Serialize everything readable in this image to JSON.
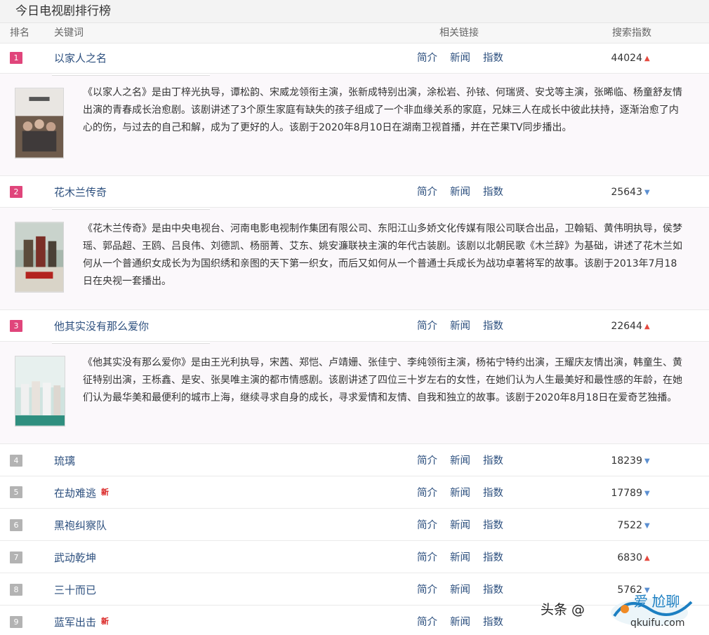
{
  "page": {
    "title": "今日电视剧排行榜"
  },
  "table_header": {
    "rank": "排名",
    "keyword": "关键词",
    "links": "相关链接",
    "index": "搜索指数"
  },
  "link_labels": {
    "intro": "简介",
    "news": "新闻",
    "index": "指数"
  },
  "items": [
    {
      "rank": "1",
      "keyword": "以家人之名",
      "index": "44024",
      "trend": "up",
      "is_new": false,
      "description": "《以家人之名》是由丁梓光执导，谭松韵、宋威龙领衔主演，张新成特别出演，涂松岩、孙铱、何瑞贤、安戈等主演，张晞临、杨童舒友情出演的青春成长治愈剧。该剧讲述了3个原生家庭有缺失的孩子组成了一个非血缘关系的家庭，兄妹三人在成长中彼此扶持，逐渐治愈了内心的伤，与过去的自己和解，成为了更好的人。该剧于2020年8月10日在湖南卫视首播，并在芒果TV同步播出。"
    },
    {
      "rank": "2",
      "keyword": "花木兰传奇",
      "index": "25643",
      "trend": "down",
      "is_new": false,
      "description": "《花木兰传奇》是由中央电视台、河南电影电视制作集团有限公司、东阳江山多娇文化传媒有限公司联合出品，卫翰韬、黄伟明执导，侯梦瑶、郭品超、王鸥、吕良伟、刘德凯、杨丽菁、艾东、姚安濂联袂主演的年代古装剧。该剧以北朝民歌《木兰辞》为基础，讲述了花木兰如何从一个普通织女成长为为国织绣和亲图的天下第一织女，而后又如何从一个普通士兵成长为战功卓著将军的故事。该剧于2013年7月18日在央视一套播出。"
    },
    {
      "rank": "3",
      "keyword": "他其实没有那么爱你",
      "index": "22644",
      "trend": "up",
      "is_new": false,
      "description": "《他其实没有那么爱你》是由王光利执导，宋茜、郑恺、卢靖姗、张佳宁、李纯领衔主演，杨祐宁特约出演，王耀庆友情出演，韩童生、黄征特别出演，王栎鑫、是安、张昊唯主演的都市情感剧。该剧讲述了四位三十岁左右的女性，在她们认为人生最美好和最性感的年龄，在她们认为最华美和最便利的城市上海，继续寻求自身的成长，寻求爱情和友情、自我和独立的故事。该剧于2020年8月18日在爱奇艺独播。"
    },
    {
      "rank": "4",
      "keyword": "琉璃",
      "index": "18239",
      "trend": "down",
      "is_new": false
    },
    {
      "rank": "5",
      "keyword": "在劫难逃",
      "index": "17789",
      "trend": "down",
      "is_new": true
    },
    {
      "rank": "6",
      "keyword": "黑袍纠察队",
      "index": "7522",
      "trend": "down",
      "is_new": false
    },
    {
      "rank": "7",
      "keyword": "武动乾坤",
      "index": "6830",
      "trend": "up",
      "is_new": false
    },
    {
      "rank": "8",
      "keyword": "三十而已",
      "index": "5762",
      "trend": "down",
      "is_new": false
    },
    {
      "rank": "9",
      "keyword": "蓝军出击",
      "index": "",
      "trend": "",
      "is_new": true
    }
  ],
  "badges": {
    "new": "新"
  },
  "icons": {
    "trend_up": "arrow-up-icon",
    "trend_down": "arrow-down-icon"
  },
  "colors": {
    "rank_top": "#e0457b",
    "rank_normal": "#b3b3b3",
    "link": "#2c4f7e",
    "trend_up": "#e5493f",
    "trend_down": "#5b8fd1"
  },
  "watermark": {
    "text": "头条 @",
    "site": "qkuifu.com"
  }
}
